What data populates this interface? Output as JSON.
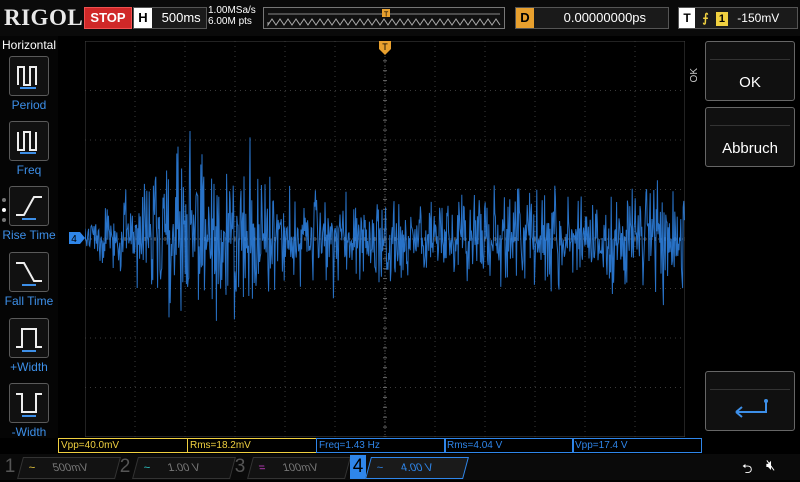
{
  "header": {
    "brand": "RIGOL",
    "run_state": "STOP",
    "timebase_label": "H",
    "timebase_value": "500ms",
    "sample_rate": "1.00MSa/s",
    "memory_depth": "6.00M pts",
    "trigger_marker": "T",
    "delay_label": "D",
    "delay_value": "0.00000000ps",
    "trigger_label": "T",
    "trigger_channel": "1",
    "trigger_level": "-150mV"
  },
  "left_menu": {
    "title": "Horizontal",
    "items": [
      {
        "label": "Period",
        "icon": "period-icon"
      },
      {
        "label": "Freq",
        "icon": "frequency-icon"
      },
      {
        "label": "Rise Time",
        "icon": "rise-time-icon"
      },
      {
        "label": "Fall Time",
        "icon": "fall-time-icon"
      },
      {
        "label": "+Width",
        "icon": "positive-width-icon"
      },
      {
        "label": "-Width",
        "icon": "negative-width-icon"
      }
    ]
  },
  "waveform": {
    "channel_marker": "4",
    "trigger_marker": "T",
    "color": "#2f86ea"
  },
  "right_menu": {
    "side_label": "OK",
    "ok_label": "OK",
    "cancel_label": "Abbruch",
    "enter_icon": "enter-icon"
  },
  "measurements": [
    {
      "text": "Vpp=40.0mV",
      "color": "#f0d040"
    },
    {
      "text": "Rms=18.2mV",
      "color": "#f0d040"
    },
    {
      "text": "Freq=1.43 Hz",
      "color": "#2f86ea"
    },
    {
      "text": "Rms=4.04 V",
      "color": "#2f86ea"
    },
    {
      "text": "Vpp=17.4 V",
      "color": "#2f86ea"
    }
  ],
  "channels": [
    {
      "num": "1",
      "coupling": "~",
      "scale": "500mV",
      "color": "#f0d040",
      "active": false
    },
    {
      "num": "2",
      "coupling": "~",
      "scale": "1.00 V",
      "color": "#30d0d0",
      "active": false
    },
    {
      "num": "3",
      "coupling": "=",
      "scale": "100mV",
      "color": "#d040d0",
      "active": false
    },
    {
      "num": "4",
      "coupling": "~",
      "scale": "4.00 V",
      "color": "#2f86ea",
      "active": true
    }
  ],
  "status_icons": [
    "usb-icon",
    "mute-icon"
  ],
  "colors": {
    "stop": "#d02828",
    "trigger": "#e8a02e",
    "menu_text": "#3d8fe8"
  }
}
